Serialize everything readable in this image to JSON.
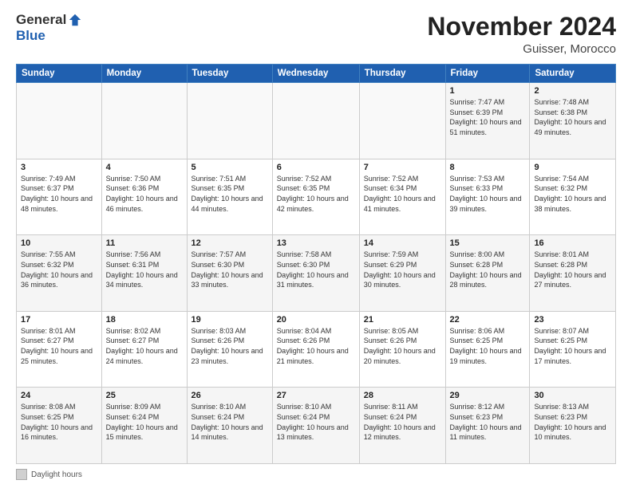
{
  "logo": {
    "general": "General",
    "blue": "Blue"
  },
  "header": {
    "month_year": "November 2024",
    "location": "Guisser, Morocco"
  },
  "weekdays": [
    "Sunday",
    "Monday",
    "Tuesday",
    "Wednesday",
    "Thursday",
    "Friday",
    "Saturday"
  ],
  "legend": {
    "label": "Daylight hours"
  },
  "weeks": [
    [
      {
        "day": "",
        "info": ""
      },
      {
        "day": "",
        "info": ""
      },
      {
        "day": "",
        "info": ""
      },
      {
        "day": "",
        "info": ""
      },
      {
        "day": "",
        "info": ""
      },
      {
        "day": "1",
        "info": "Sunrise: 7:47 AM\nSunset: 6:39 PM\nDaylight: 10 hours and 51 minutes."
      },
      {
        "day": "2",
        "info": "Sunrise: 7:48 AM\nSunset: 6:38 PM\nDaylight: 10 hours and 49 minutes."
      }
    ],
    [
      {
        "day": "3",
        "info": "Sunrise: 7:49 AM\nSunset: 6:37 PM\nDaylight: 10 hours and 48 minutes."
      },
      {
        "day": "4",
        "info": "Sunrise: 7:50 AM\nSunset: 6:36 PM\nDaylight: 10 hours and 46 minutes."
      },
      {
        "day": "5",
        "info": "Sunrise: 7:51 AM\nSunset: 6:35 PM\nDaylight: 10 hours and 44 minutes."
      },
      {
        "day": "6",
        "info": "Sunrise: 7:52 AM\nSunset: 6:35 PM\nDaylight: 10 hours and 42 minutes."
      },
      {
        "day": "7",
        "info": "Sunrise: 7:52 AM\nSunset: 6:34 PM\nDaylight: 10 hours and 41 minutes."
      },
      {
        "day": "8",
        "info": "Sunrise: 7:53 AM\nSunset: 6:33 PM\nDaylight: 10 hours and 39 minutes."
      },
      {
        "day": "9",
        "info": "Sunrise: 7:54 AM\nSunset: 6:32 PM\nDaylight: 10 hours and 38 minutes."
      }
    ],
    [
      {
        "day": "10",
        "info": "Sunrise: 7:55 AM\nSunset: 6:32 PM\nDaylight: 10 hours and 36 minutes."
      },
      {
        "day": "11",
        "info": "Sunrise: 7:56 AM\nSunset: 6:31 PM\nDaylight: 10 hours and 34 minutes."
      },
      {
        "day": "12",
        "info": "Sunrise: 7:57 AM\nSunset: 6:30 PM\nDaylight: 10 hours and 33 minutes."
      },
      {
        "day": "13",
        "info": "Sunrise: 7:58 AM\nSunset: 6:30 PM\nDaylight: 10 hours and 31 minutes."
      },
      {
        "day": "14",
        "info": "Sunrise: 7:59 AM\nSunset: 6:29 PM\nDaylight: 10 hours and 30 minutes."
      },
      {
        "day": "15",
        "info": "Sunrise: 8:00 AM\nSunset: 6:28 PM\nDaylight: 10 hours and 28 minutes."
      },
      {
        "day": "16",
        "info": "Sunrise: 8:01 AM\nSunset: 6:28 PM\nDaylight: 10 hours and 27 minutes."
      }
    ],
    [
      {
        "day": "17",
        "info": "Sunrise: 8:01 AM\nSunset: 6:27 PM\nDaylight: 10 hours and 25 minutes."
      },
      {
        "day": "18",
        "info": "Sunrise: 8:02 AM\nSunset: 6:27 PM\nDaylight: 10 hours and 24 minutes."
      },
      {
        "day": "19",
        "info": "Sunrise: 8:03 AM\nSunset: 6:26 PM\nDaylight: 10 hours and 23 minutes."
      },
      {
        "day": "20",
        "info": "Sunrise: 8:04 AM\nSunset: 6:26 PM\nDaylight: 10 hours and 21 minutes."
      },
      {
        "day": "21",
        "info": "Sunrise: 8:05 AM\nSunset: 6:26 PM\nDaylight: 10 hours and 20 minutes."
      },
      {
        "day": "22",
        "info": "Sunrise: 8:06 AM\nSunset: 6:25 PM\nDaylight: 10 hours and 19 minutes."
      },
      {
        "day": "23",
        "info": "Sunrise: 8:07 AM\nSunset: 6:25 PM\nDaylight: 10 hours and 17 minutes."
      }
    ],
    [
      {
        "day": "24",
        "info": "Sunrise: 8:08 AM\nSunset: 6:25 PM\nDaylight: 10 hours and 16 minutes."
      },
      {
        "day": "25",
        "info": "Sunrise: 8:09 AM\nSunset: 6:24 PM\nDaylight: 10 hours and 15 minutes."
      },
      {
        "day": "26",
        "info": "Sunrise: 8:10 AM\nSunset: 6:24 PM\nDaylight: 10 hours and 14 minutes."
      },
      {
        "day": "27",
        "info": "Sunrise: 8:10 AM\nSunset: 6:24 PM\nDaylight: 10 hours and 13 minutes."
      },
      {
        "day": "28",
        "info": "Sunrise: 8:11 AM\nSunset: 6:24 PM\nDaylight: 10 hours and 12 minutes."
      },
      {
        "day": "29",
        "info": "Sunrise: 8:12 AM\nSunset: 6:23 PM\nDaylight: 10 hours and 11 minutes."
      },
      {
        "day": "30",
        "info": "Sunrise: 8:13 AM\nSunset: 6:23 PM\nDaylight: 10 hours and 10 minutes."
      }
    ]
  ]
}
